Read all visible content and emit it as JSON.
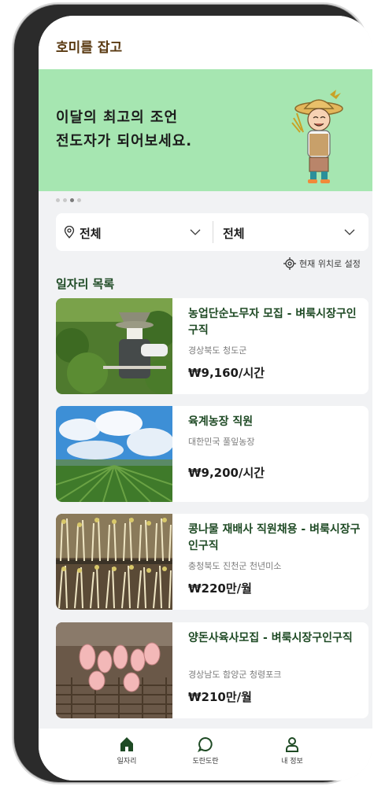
{
  "app": {
    "title": "호미를 잡고"
  },
  "banner": {
    "line1": "이달의 최고의 조언",
    "line2": "전도자가 되어보세요.",
    "illustration": "farmer-illustration"
  },
  "carousel": {
    "total": 4,
    "active": 3
  },
  "filter": {
    "region_label": "전체",
    "region_icon": "location-pin-icon",
    "category_label": "전체",
    "dropdown_icon": "chevron-down-icon"
  },
  "location_setting": {
    "label": "현재 위치로 설정",
    "icon": "crosshair-icon"
  },
  "job_list": {
    "title": "일자리 목록",
    "items": [
      {
        "title": "농업단순노무자 모집 - 벼룩시장구인구직",
        "location": "경상북도 청도군",
        "pay": "₩9,160/시간",
        "image": "farm-worker-photo"
      },
      {
        "title": "육계농장 직원",
        "location": "대한민국 풀잎농장",
        "pay": "₩9,200/시간",
        "image": "field-sky-photo"
      },
      {
        "title": "콩나물 재배사 직원채용 - 벼룩시장구인구직",
        "location": "충청북도 진천군 천년미소",
        "pay": "₩220만/월",
        "image": "bean-sprouts-photo"
      },
      {
        "title": "양돈사육사모집 - 벼룩시장구인구직",
        "location": "경상남도 함양군 청령포크",
        "pay": "₩210만/월",
        "image": "piglets-photo"
      }
    ]
  },
  "bottom_nav": [
    {
      "label": "일자리",
      "icon": "home-icon"
    },
    {
      "label": "도란도란",
      "icon": "chat-bubble-icon"
    },
    {
      "label": "내 정보",
      "icon": "person-icon"
    }
  ],
  "colors": {
    "brand_brown": "#5a3a12",
    "banner_green": "#a6e6b1",
    "title_green": "#1e4a24",
    "background": "#f1f2f4"
  }
}
